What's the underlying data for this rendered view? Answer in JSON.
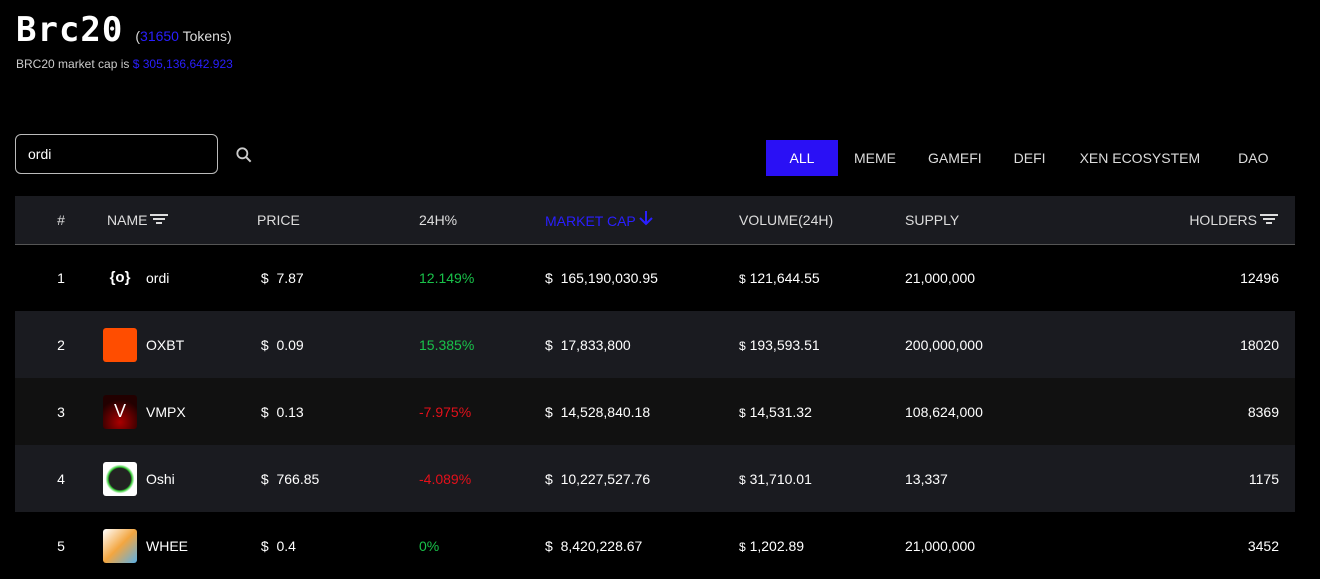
{
  "header": {
    "title": "Brc20",
    "token_count": "31650",
    "tokens_label": "Tokens",
    "mcap_label": "BRC20 market cap is",
    "mcap_value": "$ 305,136,642.923"
  },
  "search": {
    "value": "ordi"
  },
  "tabs": [
    "ALL",
    "MEME",
    "GAMEFI",
    "DEFI",
    "XEN ECOSYSTEM",
    "DAO"
  ],
  "columns": [
    "#",
    "NAME",
    "PRICE",
    "24H%",
    "MARKET CAP",
    "VOLUME(24H)",
    "SUPPLY",
    "HOLDERS"
  ],
  "rows": [
    {
      "rank": "1",
      "name": "ordi",
      "price": "7.87",
      "change": "12.149%",
      "mcap": "165,190,030.95",
      "volume": "121,644.55",
      "supply": "21,000,000",
      "holders": "12496"
    },
    {
      "rank": "2",
      "name": "OXBT",
      "price": "0.09",
      "change": "15.385%",
      "mcap": "17,833,800",
      "volume": "193,593.51",
      "supply": "200,000,000",
      "holders": "18020"
    },
    {
      "rank": "3",
      "name": "VMPX",
      "price": "0.13",
      "change": "-7.975%",
      "mcap": "14,528,840.18",
      "volume": "14,531.32",
      "supply": "108,624,000",
      "holders": "8369"
    },
    {
      "rank": "4",
      "name": "Oshi",
      "price": "766.85",
      "change": "-4.089%",
      "mcap": "10,227,527.76",
      "volume": "31,710.01",
      "supply": "13,337",
      "holders": "1175"
    },
    {
      "rank": "5",
      "name": "WHEE",
      "price": "0.4",
      "change": "0%",
      "mcap": "8,420,228.67",
      "volume": "1,202.89",
      "supply": "21,000,000",
      "holders": "3452"
    }
  ],
  "colors": {
    "accent": "#2a10f5",
    "up": "#19c24a",
    "down": "#e3101a"
  }
}
